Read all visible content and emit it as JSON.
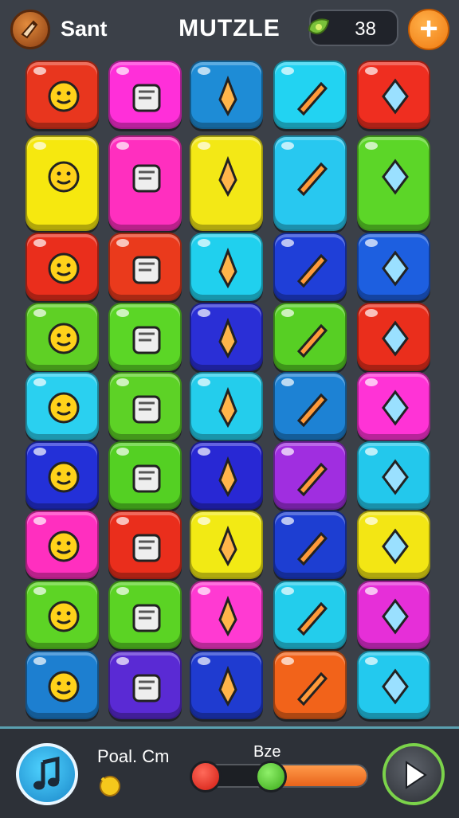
{
  "header": {
    "player_name": "Sant",
    "title": "MUTZLE",
    "coin_count": "38",
    "add_label": "+"
  },
  "grid": {
    "tiles": [
      {
        "row": 0,
        "col": 0,
        "color": "#e8361e",
        "icon": "smiley-pendant-icon"
      },
      {
        "row": 0,
        "col": 1,
        "color": "#ff2fd9",
        "icon": "bear-face-icon"
      },
      {
        "row": 0,
        "col": 2,
        "color": "#1e8cd6",
        "icon": "cotton-candy-icon"
      },
      {
        "row": 0,
        "col": 3,
        "color": "#22d3f2",
        "icon": "notepad-pencil-icon"
      },
      {
        "row": 0,
        "col": 4,
        "color": "#ef2e20",
        "icon": "popsicle-icon"
      },
      {
        "row": 1,
        "col": 0,
        "color": "#f6e80f",
        "icon": "radio-and-dropper-icon",
        "tall": true
      },
      {
        "row": 1,
        "col": 1,
        "color": "#ff2fbf",
        "icon": "balloon-and-leaf-icon",
        "tall": true
      },
      {
        "row": 1,
        "col": 2,
        "color": "#f3e816",
        "icon": "ice-cream-cone-icon",
        "tall": true
      },
      {
        "row": 1,
        "col": 3,
        "color": "#28c8f0",
        "icon": "carrot-creature-icon",
        "tall": true
      },
      {
        "row": 1,
        "col": 4,
        "color": "#5cd628",
        "icon": "palm-plant-icon",
        "tall": true
      },
      {
        "row": 2,
        "col": 0,
        "color": "#ea2e1c",
        "icon": "snowman-face-icon"
      },
      {
        "row": 2,
        "col": 1,
        "color": "#ea3a1c",
        "icon": "pencil-icon"
      },
      {
        "row": 2,
        "col": 2,
        "color": "#20d0ee",
        "icon": "chat-bubble-icon"
      },
      {
        "row": 2,
        "col": 3,
        "color": "#1f3fd8",
        "icon": "crossed-tools-icon"
      },
      {
        "row": 2,
        "col": 4,
        "color": "#1d5fe0",
        "icon": "camera-icon"
      },
      {
        "row": 3,
        "col": 0,
        "color": "#5fd025",
        "icon": "pumpkin-icon"
      },
      {
        "row": 3,
        "col": 1,
        "color": "#5bd626",
        "icon": "star-icon"
      },
      {
        "row": 3,
        "col": 2,
        "color": "#2a2fd6",
        "icon": "bow-icon"
      },
      {
        "row": 3,
        "col": 3,
        "color": "#57cf24",
        "icon": "tv-screen-icon"
      },
      {
        "row": 3,
        "col": 4,
        "color": "#ea2e1c",
        "icon": "crayon-icon"
      },
      {
        "row": 4,
        "col": 0,
        "color": "#2ad0f0",
        "icon": "lollipop-icon"
      },
      {
        "row": 4,
        "col": 1,
        "color": "#5dd226",
        "icon": "bear-with-pencil-icon"
      },
      {
        "row": 4,
        "col": 2,
        "color": "#24cdec",
        "icon": "giraffe-icon"
      },
      {
        "row": 4,
        "col": 3,
        "color": "#1d82d4",
        "icon": "heart-fruit-icon"
      },
      {
        "row": 4,
        "col": 4,
        "color": "#ff33d6",
        "icon": "paper-plane-icon"
      },
      {
        "row": 5,
        "col": 0,
        "color": "#2330d8",
        "icon": "maraca-icon"
      },
      {
        "row": 5,
        "col": 1,
        "color": "#54d023",
        "icon": "cassette-icon"
      },
      {
        "row": 5,
        "col": 2,
        "color": "#2828d4",
        "icon": "bear-head-icon"
      },
      {
        "row": 5,
        "col": 3,
        "color": "#a02ee0",
        "icon": "picture-frame-icon"
      },
      {
        "row": 5,
        "col": 4,
        "color": "#23c8ec",
        "icon": "glue-bottle-icon"
      },
      {
        "row": 6,
        "col": 0,
        "color": "#ff2fbf",
        "icon": "hat-kid-icon"
      },
      {
        "row": 6,
        "col": 1,
        "color": "#ea2e1c",
        "icon": "mouse-face-icon"
      },
      {
        "row": 6,
        "col": 2,
        "color": "#f2ea14",
        "icon": "arrow-kite-icon"
      },
      {
        "row": 6,
        "col": 3,
        "color": "#1d3ed2",
        "icon": "lion-face-icon"
      },
      {
        "row": 6,
        "col": 4,
        "color": "#f3e614",
        "icon": "swirl-badge-icon"
      },
      {
        "row": 7,
        "col": 0,
        "color": "#5dd425",
        "icon": "shield-icon"
      },
      {
        "row": 7,
        "col": 1,
        "color": "#5bd324",
        "icon": "apple-icon"
      },
      {
        "row": 7,
        "col": 2,
        "color": "#ff3ad2",
        "icon": "flower-badge-icon"
      },
      {
        "row": 7,
        "col": 3,
        "color": "#23cdec",
        "icon": "bone-icon"
      },
      {
        "row": 7,
        "col": 4,
        "color": "#e62fd8",
        "icon": "purple-face-icon"
      },
      {
        "row": 8,
        "col": 0,
        "color": "#1d7fd0",
        "icon": "cannon-icon"
      },
      {
        "row": 8,
        "col": 1,
        "color": "#5a2ad4",
        "icon": "rocket-icon"
      },
      {
        "row": 8,
        "col": 2,
        "color": "#1f3bd0",
        "icon": "book-icon"
      },
      {
        "row": 8,
        "col": 3,
        "color": "#f2631a",
        "icon": "plant-pot-icon"
      },
      {
        "row": 8,
        "col": 4,
        "color": "#23c9ee",
        "icon": "paintbrush-icon"
      }
    ]
  },
  "footer": {
    "level_label": "Poal. Cm",
    "slider_label": "Bze",
    "slider_value": 0.45,
    "accent_color": "#7bd34a"
  }
}
